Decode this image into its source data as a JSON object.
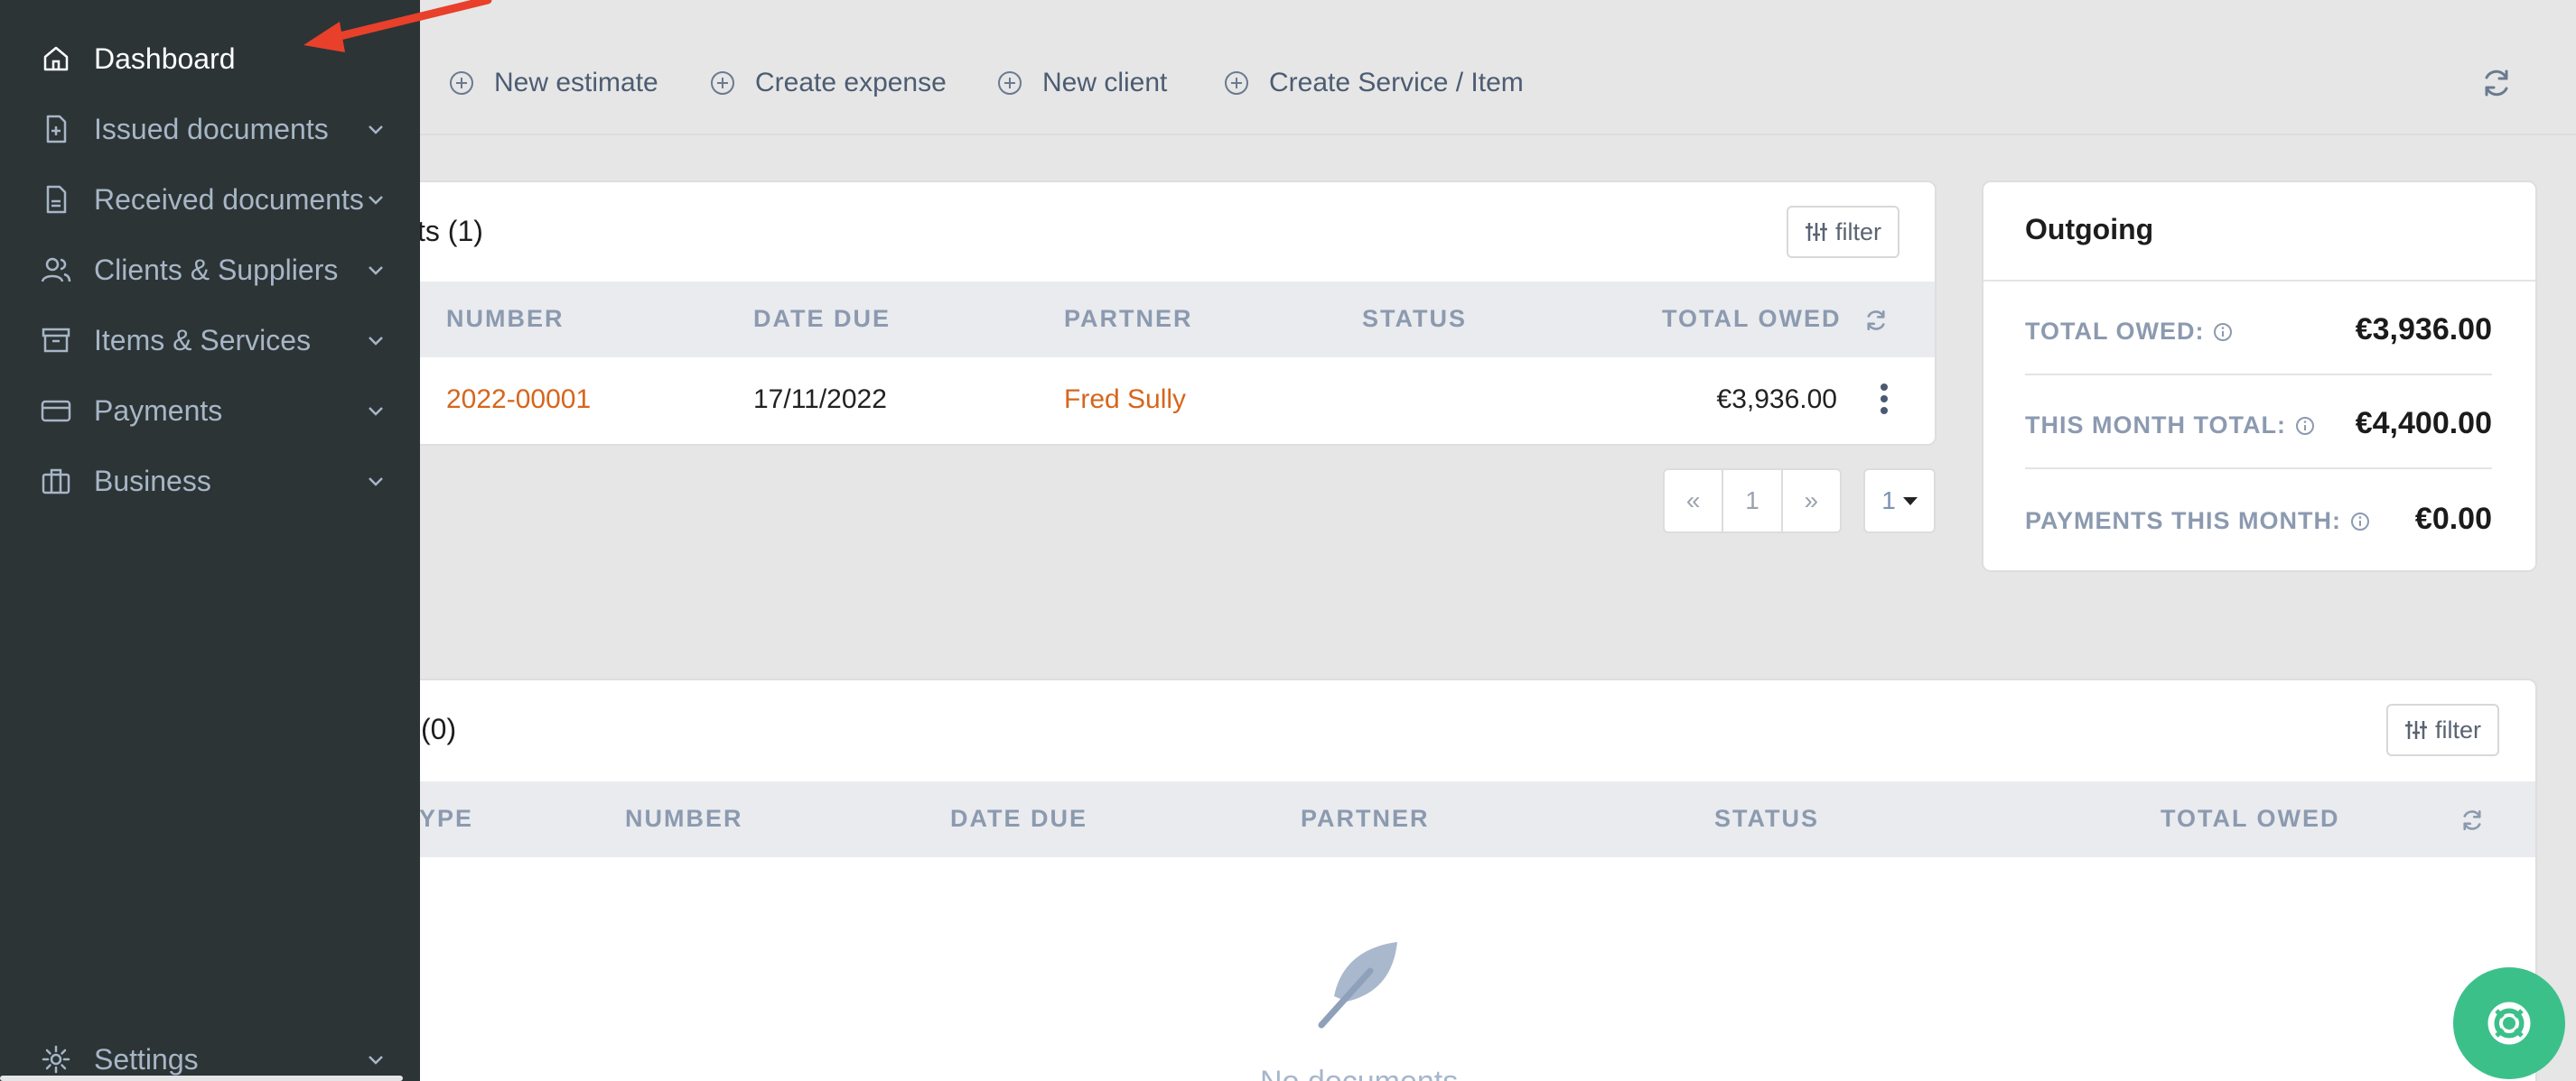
{
  "toolbar": {
    "new_estimate": "New estimate",
    "create_expense": "Create expense",
    "new_client": "New client",
    "create_service": "Create Service / Item"
  },
  "issued_card": {
    "title": "ts (1)",
    "filter": "filter",
    "columns": [
      "NUMBER",
      "DATE DUE",
      "PARTNER",
      "STATUS",
      "TOTAL OWED"
    ],
    "rows": [
      {
        "number": "2022-00001",
        "date_due": "17/11/2022",
        "partner": "Fred Sully",
        "status": "",
        "total_owed": "€3,936.00"
      }
    ],
    "pager": {
      "prev": "«",
      "page": "1",
      "next": "»",
      "per_page": "1"
    }
  },
  "outgoing": {
    "title": "Outgoing",
    "rows": [
      {
        "label": "TOTAL OWED:",
        "value": "€3,936.00"
      },
      {
        "label": "THIS MONTH TOTAL:",
        "value": "€4,400.00"
      },
      {
        "label": "PAYMENTS THIS MONTH:",
        "value": "€0.00"
      }
    ]
  },
  "received_card": {
    "title": "(0)",
    "filter": "filter",
    "columns": [
      "YPE",
      "NUMBER",
      "DATE DUE",
      "PARTNER",
      "STATUS",
      "TOTAL OWED"
    ],
    "empty_text": "No documents"
  },
  "sidebar": {
    "items": [
      {
        "label": "Dashboard",
        "icon": "home-icon"
      },
      {
        "label": "Issued documents",
        "icon": "document-plus-icon"
      },
      {
        "label": "Received documents",
        "icon": "document-icon"
      },
      {
        "label": "Clients & Suppliers",
        "icon": "users-icon"
      },
      {
        "label": "Items & Services",
        "icon": "archive-box-icon"
      },
      {
        "label": "Payments",
        "icon": "credit-card-icon"
      },
      {
        "label": "Business",
        "icon": "briefcase-icon"
      }
    ],
    "settings": "Settings"
  },
  "colors": {
    "sidebar": "#2c3436",
    "accent": "#d6661b",
    "support": "#3cc08a",
    "arrow": "#e8402a"
  }
}
